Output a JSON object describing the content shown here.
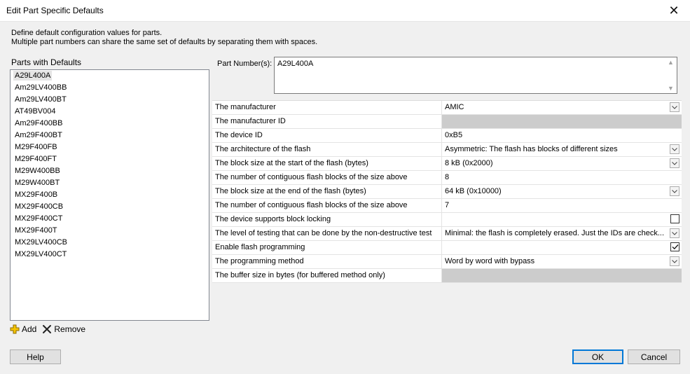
{
  "window": {
    "title": "Edit Part Specific Defaults",
    "close_glyph": "✕"
  },
  "description": {
    "line1": "Define default configuration values for parts.",
    "line2": "Multiple part numbers can share the same set of defaults by separating them with spaces."
  },
  "parts_panel": {
    "header": "Parts with Defaults",
    "selected_index": 0,
    "items": [
      "A29L400A",
      "Am29LV400BB",
      "Am29LV400BT",
      "AT49BV004",
      "Am29F400BB",
      "Am29F400BT",
      "M29F400FB",
      "M29F400FT",
      "M29W400BB",
      "M29W400BT",
      "MX29F400B",
      "MX29F400CB",
      "MX29F400CT",
      "MX29F400T",
      "MX29LV400CB",
      "MX29LV400CT"
    ],
    "add_label": "Add",
    "remove_label": "Remove",
    "add_icon": "plus-icon",
    "remove_icon": "cross-icon"
  },
  "part_number": {
    "label": "Part Number(s):",
    "value": "A29L400A"
  },
  "properties": [
    {
      "name": "The manufacturer",
      "value": "AMIC",
      "control": "dropdown"
    },
    {
      "name": "The manufacturer ID",
      "value": "",
      "control": "disabled"
    },
    {
      "name": "The device ID",
      "value": "0xB5",
      "control": "text"
    },
    {
      "name": "The architecture of the flash",
      "value": "Asymmetric: The flash has blocks of different sizes",
      "control": "dropdown"
    },
    {
      "name": "The block size at the start of the flash (bytes)",
      "value": "8 kB (0x2000)",
      "control": "dropdown"
    },
    {
      "name": "The number of contiguous flash blocks of the size above",
      "value": "8",
      "control": "text"
    },
    {
      "name": "The block size at the end of the flash (bytes)",
      "value": "64 kB (0x10000)",
      "control": "dropdown"
    },
    {
      "name": "The number of contiguous flash blocks of the size above",
      "value": "7",
      "control": "text"
    },
    {
      "name": "The device supports block locking",
      "value": "",
      "control": "checkbox",
      "checked": false
    },
    {
      "name": "The level of testing that can be done by the non-destructive test",
      "value": "Minimal: the flash is completely erased. Just the IDs are check...",
      "control": "dropdown"
    },
    {
      "name": "Enable flash programming",
      "value": "",
      "control": "checkbox",
      "checked": true
    },
    {
      "name": "The programming method",
      "value": "Word by word with bypass",
      "control": "dropdown"
    },
    {
      "name": "The buffer size in bytes (for buffered method only)",
      "value": "",
      "control": "disabled"
    }
  ],
  "buttons": {
    "help": "Help",
    "ok": "OK",
    "cancel": "Cancel"
  },
  "colors": {
    "disabled_cell": "#cccccc",
    "default_button_border": "#0078d7",
    "add_icon_color": "#e8b400"
  }
}
